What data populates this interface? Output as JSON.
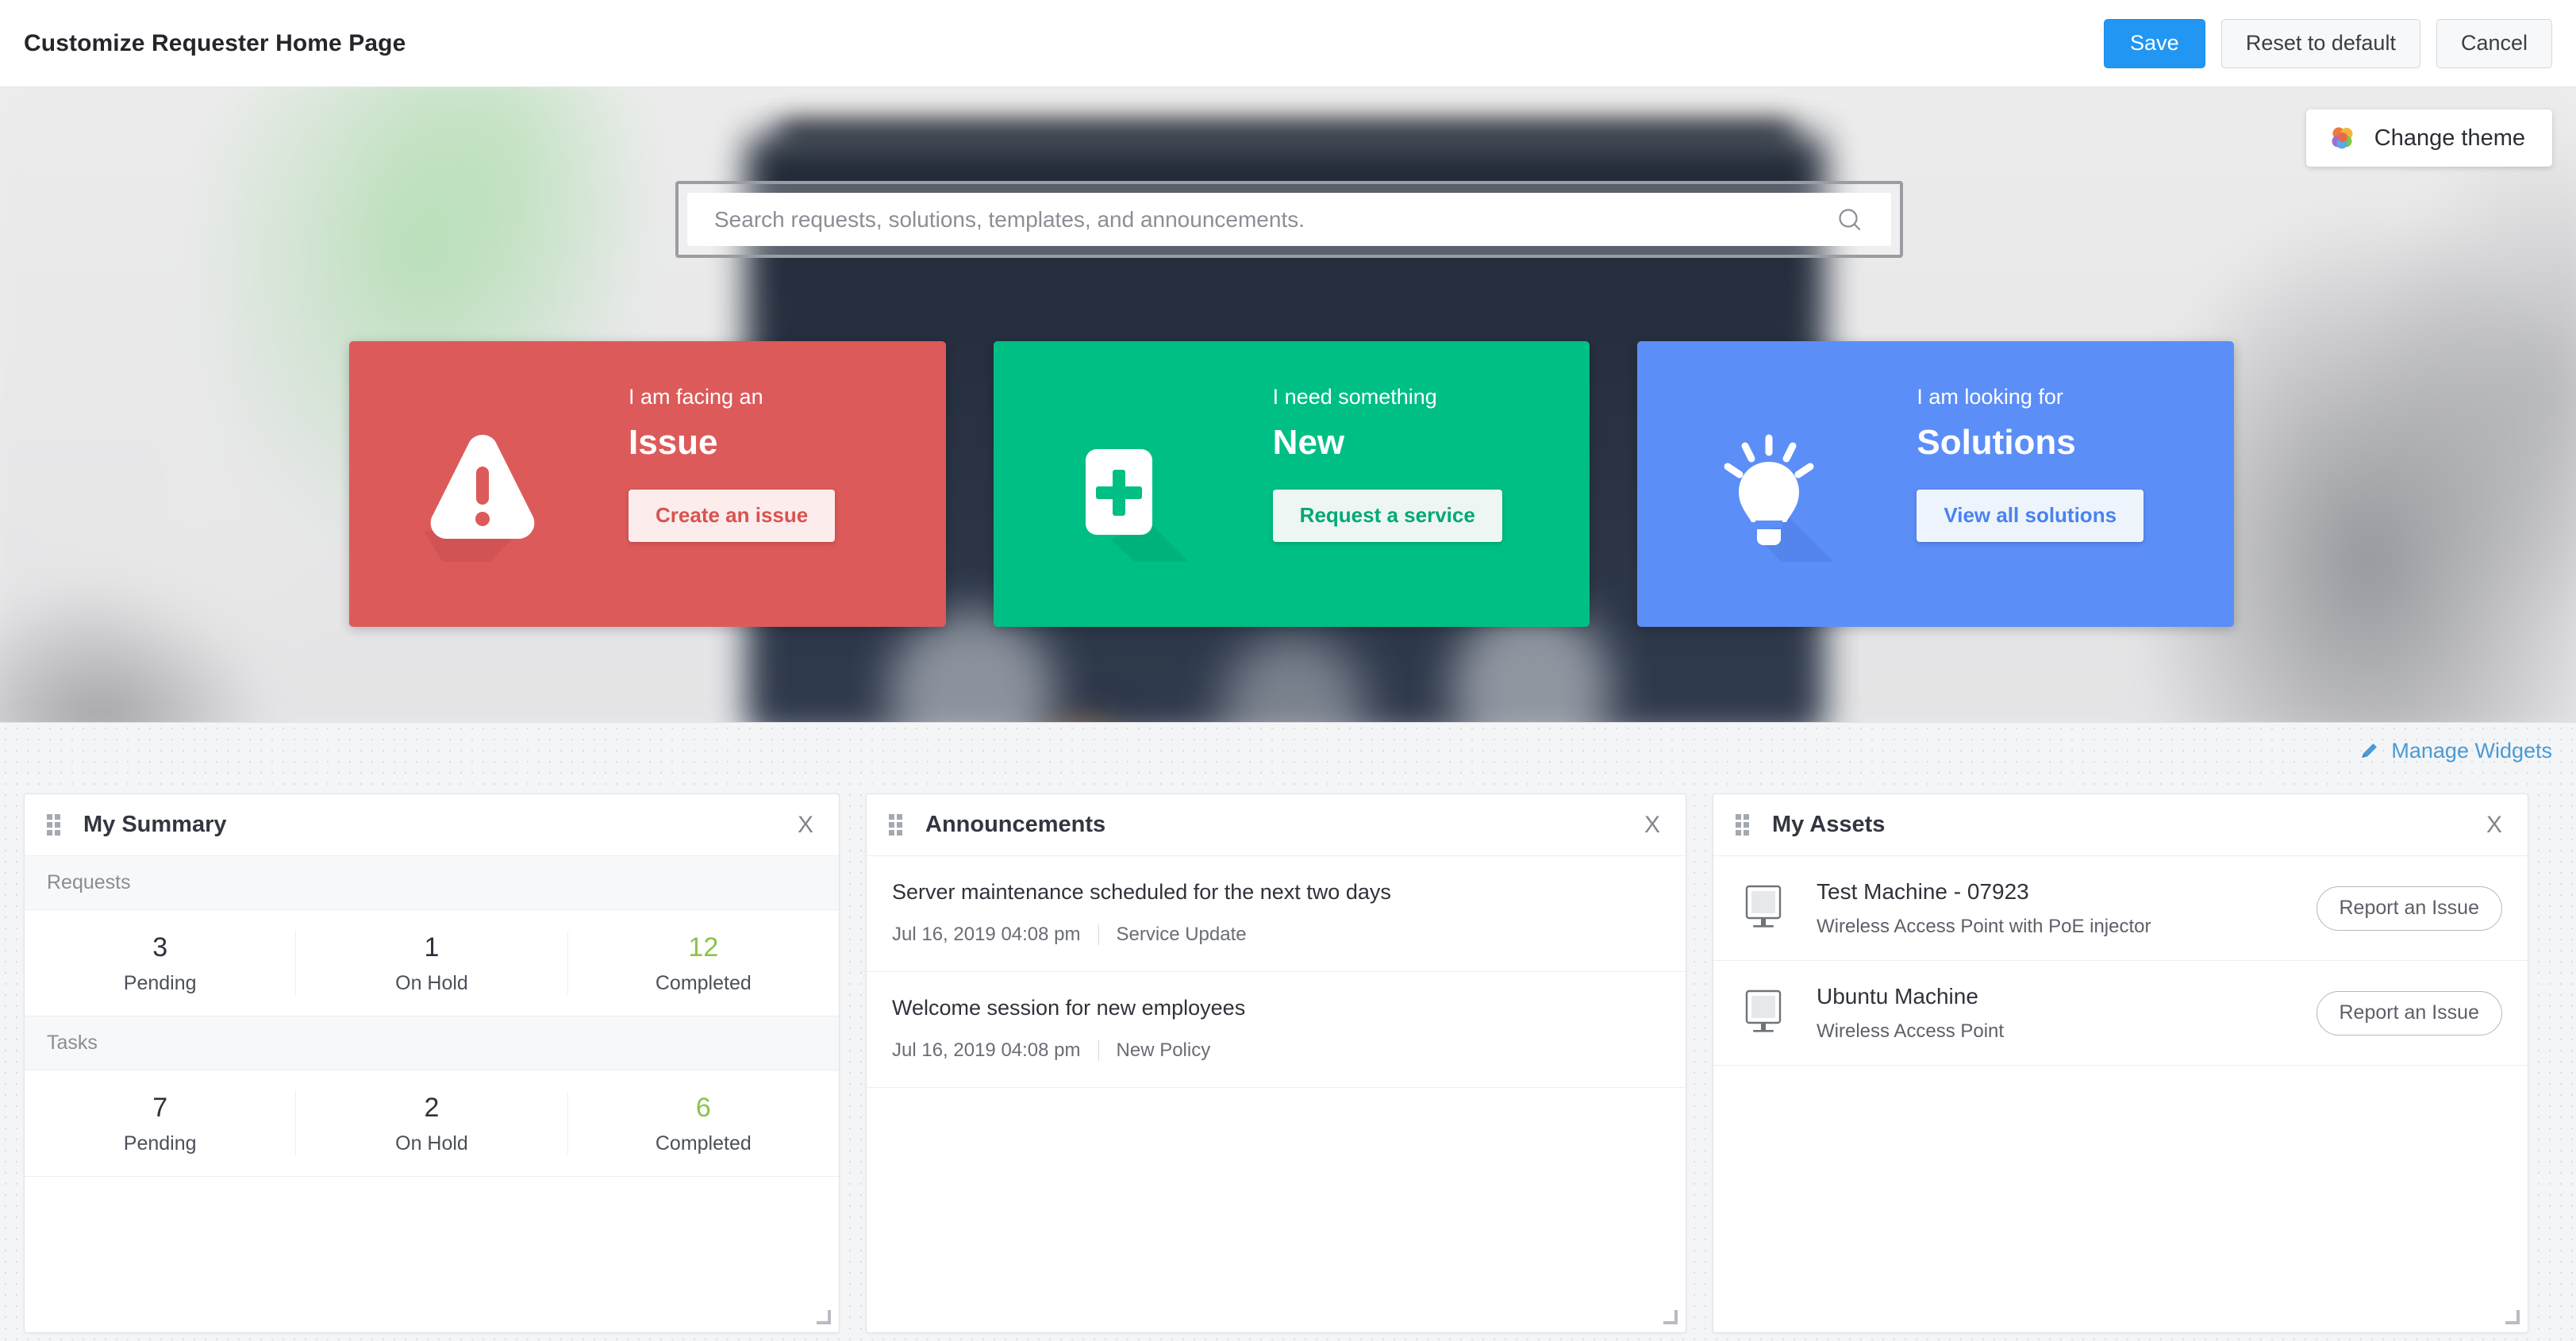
{
  "topbar": {
    "title": "Customize Requester Home Page",
    "save_label": "Save",
    "reset_label": "Reset to default",
    "cancel_label": "Cancel"
  },
  "hero": {
    "change_theme_label": "Change theme",
    "search_placeholder": "Search requests, solutions, templates, and announcements.",
    "search_value": ""
  },
  "tiles": [
    {
      "kicker": "I am facing an",
      "title": "Issue",
      "button": "Create an issue",
      "icon": "warning-triangle-icon",
      "color": "#dd5a5a"
    },
    {
      "kicker": "I need something",
      "title": "New",
      "button": "Request a service",
      "icon": "plus-square-icon",
      "color": "#00bf84"
    },
    {
      "kicker": "I am looking for",
      "title": "Solutions",
      "button": "View all solutions",
      "icon": "lightbulb-icon",
      "color": "#5c8ef7"
    }
  ],
  "widget_area": {
    "manage_widgets_label": "Manage Widgets",
    "close_label": "X"
  },
  "summary_widget": {
    "title": "My Summary",
    "sections": [
      {
        "label": "Requests",
        "stats": [
          {
            "value": "3",
            "label": "Pending",
            "accent": false
          },
          {
            "value": "1",
            "label": "On Hold",
            "accent": false
          },
          {
            "value": "12",
            "label": "Completed",
            "accent": true
          }
        ]
      },
      {
        "label": "Tasks",
        "stats": [
          {
            "value": "7",
            "label": "Pending",
            "accent": false
          },
          {
            "value": "2",
            "label": "On Hold",
            "accent": false
          },
          {
            "value": "6",
            "label": "Completed",
            "accent": true
          }
        ]
      }
    ]
  },
  "announcements_widget": {
    "title": "Announcements",
    "items": [
      {
        "title": "Server maintenance scheduled for the next two days",
        "date": "Jul 16, 2019 04:08 pm",
        "category": "Service Update"
      },
      {
        "title": "Welcome session for new employees",
        "date": "Jul 16, 2019 04:08 pm",
        "category": "New Policy"
      }
    ]
  },
  "assets_widget": {
    "title": "My Assets",
    "items": [
      {
        "name": "Test Machine - 07923",
        "description": "Wireless Access Point with PoE injector",
        "button": "Report an Issue"
      },
      {
        "name": "Ubuntu Machine",
        "description": "Wireless Access Point",
        "button": "Report an Issue"
      }
    ]
  },
  "colors": {
    "accent_blue": "#2196f3",
    "link_blue": "#4a9ad4",
    "issue_red": "#dd5a5a",
    "new_green": "#00bf84",
    "solutions_blue": "#5c8ef7",
    "completed_green": "#8bc34a"
  }
}
